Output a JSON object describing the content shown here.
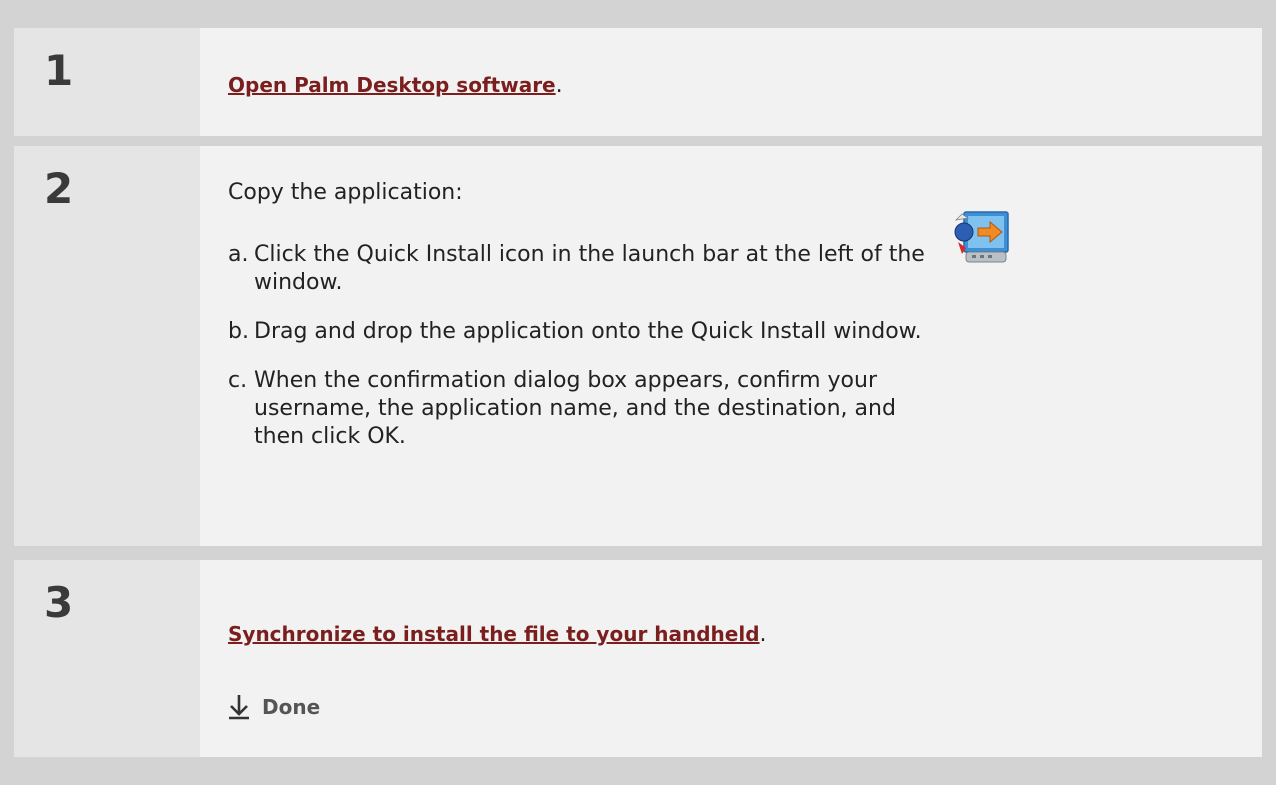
{
  "steps": [
    {
      "number": "1",
      "link": "Open Palm Desktop software",
      "suffix": "."
    },
    {
      "number": "2",
      "intro": "Copy the application:",
      "substeps": [
        {
          "letter": "a.",
          "text": "Click the Quick Install icon in the launch bar at the left of the window."
        },
        {
          "letter": "b.",
          "text": "Drag and drop the application onto the Quick Install window."
        },
        {
          "letter": "c.",
          "text": "When the confirmation dialog box appears, confirm your username, the application name, and the destination, and then click OK."
        }
      ],
      "icon": "quick-install-icon"
    },
    {
      "number": "3",
      "link": "Synchronize to install the file to your handheld",
      "suffix": ".",
      "done": "Done",
      "done_icon": "down-arrow-icon"
    }
  ],
  "colors": {
    "link": "#7a1e1e",
    "number_bg": "#e5e5e5",
    "content_bg": "#f2f2f2",
    "page_bg": "#d3d3d3"
  }
}
